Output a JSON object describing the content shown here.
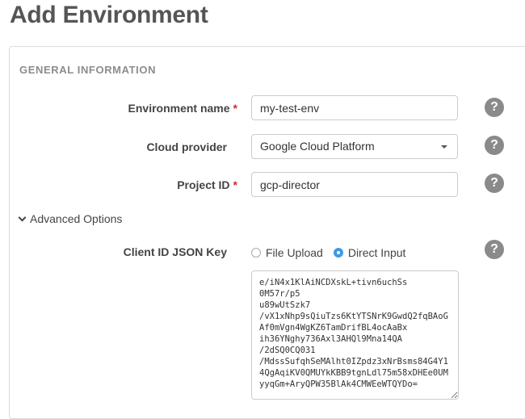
{
  "page": {
    "title": "Add Environment"
  },
  "section": {
    "title": "GENERAL INFORMATION"
  },
  "fields": {
    "environment_name": {
      "label": "Environment name",
      "required_mark": "*",
      "value": "my-test-env",
      "help_icon": "question-circle-icon",
      "help_glyph": "?"
    },
    "cloud_provider": {
      "label": "Cloud provider",
      "value": "Google Cloud Platform",
      "help_icon": "question-circle-icon",
      "help_glyph": "?"
    },
    "project_id": {
      "label": "Project ID",
      "required_mark": "*",
      "value": "gcp-director",
      "help_icon": "question-circle-icon",
      "help_glyph": "?"
    }
  },
  "advanced": {
    "toggle_label": "Advanced Options",
    "expanded": true,
    "client_id_json_key": {
      "label": "Client ID JSON Key",
      "options": [
        {
          "label": "File Upload",
          "checked": false
        },
        {
          "label": "Direct Input",
          "checked": true
        }
      ],
      "help_glyph": "?",
      "value": "e/iN4x1KlAiNCDXskL+tivn6uchSs\n0M57r/p5\nu89wUtSzk7\n/vX1xNhp9sQiuTzs6KtYTSNrK9GwdQ2fqBAoG\nAf0mVgn4WgKZ6TamDrifBL4ocAaBx\nih36YNghy736Axl3AHQl9Mna14QA\n/2dSQ0CQ031\n/MdssSufqhSeMAlht0IZpdz3xNrBsms84G4Y1\n4QgAqiKV0QMUYkKBB9tgnLdl75m58xDHEe0UM\nyyqGm+AryQPW35BlAk4CMWEeWTQYDo="
    }
  },
  "colors": {
    "required": "#c9302c",
    "radio_checked": "#3d9ae8",
    "help_icon_bg": "#8a8a8a",
    "section_title": "#8c8c8c"
  }
}
